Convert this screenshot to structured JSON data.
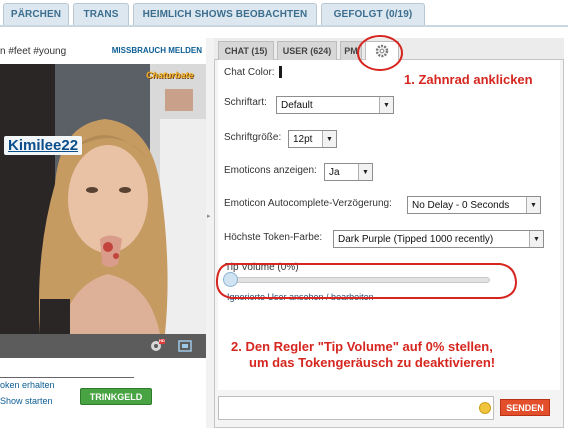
{
  "top_tabs": [
    "PÄRCHEN",
    "TRANS",
    "HEIMLICH SHOWS BEOBACHTEN",
    "GEFOLGT (0/19)"
  ],
  "video_panel": {
    "room_subject": "n #feet #young",
    "report_link": "MISSBRAUCH MELDEN",
    "broadcaster_name": "Kimilee22",
    "watermark": "Chaturbate",
    "hd_badge": "HD",
    "tokens_text": "oken erhalten",
    "show_text": "Show starten",
    "tip_button": "TRINKGELD"
  },
  "panel_tabs": {
    "chat": "CHAT (15)",
    "users": "USER (624)",
    "pm": "PM",
    "settings_icon": "gear-icon"
  },
  "settings": {
    "chat_color_label": "Chat Color:",
    "font_label": "Schriftart:",
    "font_value": "Default",
    "font_size_label": "Schriftgröße:",
    "font_size_value": "12pt",
    "emoticons_label": "Emoticons anzeigen:",
    "emoticons_value": "Ja",
    "autocomplete_label": "Emoticon Autocomplete-Verzögerung:",
    "autocomplete_value": "No Delay - 0 Seconds",
    "highest_token_color_label": "Höchste Token-Farbe:",
    "highest_token_color_value": "Dark Purple (Tipped 1000 recently)",
    "tip_volume_label": "Tip Volume (0%)",
    "tip_volume_value": 0,
    "ignore_users_link": "Ignorierte User ansehen / bearbeiten"
  },
  "chat_input": {
    "value": "",
    "send_button": "SENDEN"
  },
  "annotations": {
    "step1": "1. Zahnrad anklicken",
    "step2_line1": "2. Den Regler \"Tip Volume\" auf 0% stellen,",
    "step2_line2": "um das Tokengeräusch zu deaktivieren!"
  },
  "colors": {
    "annotation_red": "#d6261f",
    "tab_blue": "#3c6e8f",
    "tip_green": "#48a342",
    "send_red": "#e44f2b"
  }
}
